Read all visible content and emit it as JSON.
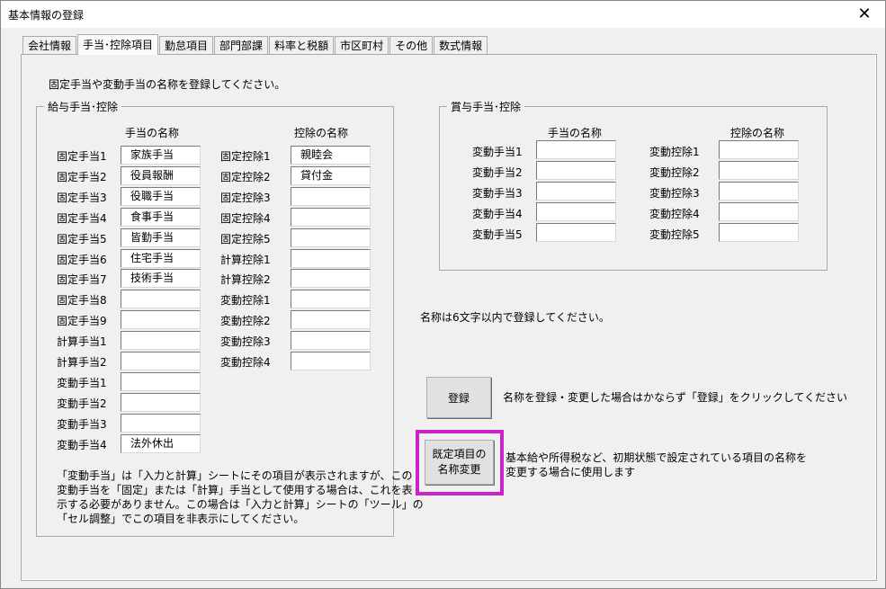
{
  "window": {
    "title": "基本情報の登録",
    "close_glyph": "✕"
  },
  "tabs": [
    "会社情報",
    "手当･控除項目",
    "勤怠項目",
    "部門部課",
    "料率と税額",
    "市区町村",
    "その他",
    "数式情報"
  ],
  "instruction": "固定手当や変動手当の名称を登録してください。",
  "salary_group": {
    "title": "給与手当･控除",
    "allowance_header": "手当の名称",
    "deduction_header": "控除の名称",
    "allowances": [
      {
        "label": "固定手当1",
        "value": "家族手当"
      },
      {
        "label": "固定手当2",
        "value": "役員報酬"
      },
      {
        "label": "固定手当3",
        "value": "役職手当"
      },
      {
        "label": "固定手当4",
        "value": "食事手当"
      },
      {
        "label": "固定手当5",
        "value": "皆勤手当"
      },
      {
        "label": "固定手当6",
        "value": "住宅手当"
      },
      {
        "label": "固定手当7",
        "value": "技術手当"
      },
      {
        "label": "固定手当8",
        "value": ""
      },
      {
        "label": "固定手当9",
        "value": ""
      },
      {
        "label": "計算手当1",
        "value": ""
      },
      {
        "label": "計算手当2",
        "value": ""
      },
      {
        "label": "変動手当1",
        "value": ""
      },
      {
        "label": "変動手当2",
        "value": ""
      },
      {
        "label": "変動手当3",
        "value": ""
      },
      {
        "label": "変動手当4",
        "value": "法外休出"
      }
    ],
    "deductions": [
      {
        "label": "固定控除1",
        "value": "親睦会"
      },
      {
        "label": "固定控除2",
        "value": "貸付金"
      },
      {
        "label": "固定控除3",
        "value": ""
      },
      {
        "label": "固定控除4",
        "value": ""
      },
      {
        "label": "固定控除5",
        "value": ""
      },
      {
        "label": "計算控除1",
        "value": ""
      },
      {
        "label": "計算控除2",
        "value": ""
      },
      {
        "label": "変動控除1",
        "value": ""
      },
      {
        "label": "変動控除2",
        "value": ""
      },
      {
        "label": "変動控除3",
        "value": ""
      },
      {
        "label": "変動控除4",
        "value": ""
      }
    ],
    "note": [
      "「変動手当」は「入力と計算」シートにその項目が表示されますが、この",
      "変動手当を「固定」または「計算」手当として使用する場合は、これを表",
      "示する必要がありません。この場合は「入力と計算」シートの「ツール」の",
      "「セル調整」でこの項目を非表示にしてください。"
    ]
  },
  "bonus_group": {
    "title": "賞与手当･控除",
    "allowance_header": "手当の名称",
    "deduction_header": "控除の名称",
    "allowances": [
      {
        "label": "変動手当1",
        "value": ""
      },
      {
        "label": "変動手当2",
        "value": ""
      },
      {
        "label": "変動手当3",
        "value": ""
      },
      {
        "label": "変動手当4",
        "value": ""
      },
      {
        "label": "変動手当5",
        "value": ""
      }
    ],
    "deductions": [
      {
        "label": "変動控除1",
        "value": ""
      },
      {
        "label": "変動控除2",
        "value": ""
      },
      {
        "label": "変動控除3",
        "value": ""
      },
      {
        "label": "変動控除4",
        "value": ""
      },
      {
        "label": "変動控除5",
        "value": ""
      }
    ]
  },
  "name_limit_note": "名称は6文字以内で登録してください。",
  "register": {
    "label": "登録",
    "note": "名称を登録・変更した場合はかならず「登録」をクリックしてください"
  },
  "rename_default": {
    "label_line1": "既定項目の",
    "label_line2": "名称変更",
    "note_line1": "基本給や所得税など、初期状態で設定されている項目の名称を",
    "note_line2": "変更する場合に使用します",
    "highlight_color": "#cc22cc"
  }
}
